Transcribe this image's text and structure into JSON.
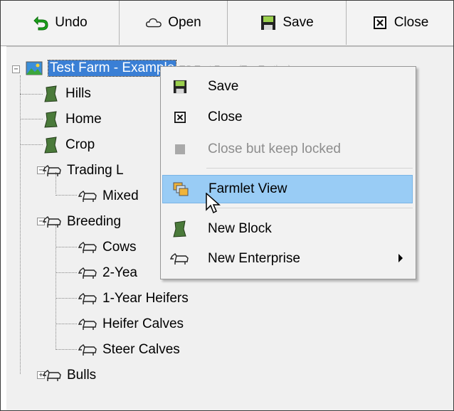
{
  "toolbar": {
    "undo": "Undo",
    "open": "Open",
    "save": "Save",
    "close": "Close"
  },
  "tree": {
    "root": "Test Farm - Example",
    "root_suffix": "TO Test Farm (Tag Testing)",
    "blocks": [
      "Hills",
      "Home",
      "Crop"
    ],
    "trading_label": "Trading L",
    "trading_child": "Mixed",
    "breeding_label": "Breeding",
    "breeding_children": [
      "Cows",
      "2-Yea",
      "1-Year Heifers",
      "Heifer Calves",
      "Steer Calves"
    ],
    "bulls_label": "Bulls"
  },
  "context_menu": {
    "save": "Save",
    "close": "Close",
    "close_locked": "Close but keep locked",
    "farmlet_view": "Farmlet View",
    "new_block": "New Block",
    "new_enterprise": "New Enterprise"
  },
  "colors": {
    "selection": "#3a7fd5",
    "hover": "#99ccf5",
    "block_green": "#4a7a3a",
    "undo_green": "#1aa51a"
  }
}
